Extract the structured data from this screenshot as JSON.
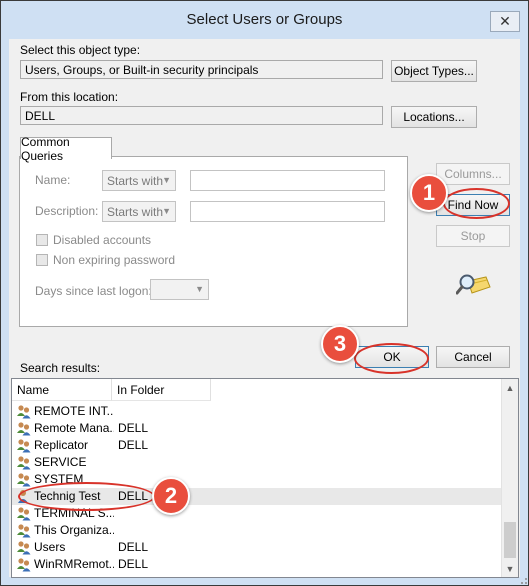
{
  "window": {
    "title": "Select Users or Groups",
    "close_glyph": "✕"
  },
  "object_type": {
    "label": "Select this object type:",
    "value": "Users, Groups, or Built-in security principals",
    "button": "Object Types..."
  },
  "location": {
    "label": "From this location:",
    "value": "DELL",
    "button": "Locations..."
  },
  "tab": {
    "label": "Common Queries"
  },
  "queries": {
    "name_label": "Name:",
    "name_mode": "Starts with",
    "description_label": "Description:",
    "description_mode": "Starts with",
    "disabled_accounts": "Disabled accounts",
    "non_expiring_password": "Non expiring password",
    "days_since_last_logon": "Days since last logon:",
    "combo_arrow": "▼"
  },
  "side_buttons": {
    "columns": "Columns...",
    "find_now": "Find Now",
    "stop": "Stop"
  },
  "actions": {
    "ok": "OK",
    "cancel": "Cancel"
  },
  "results": {
    "label": "Search results:",
    "headers": [
      "Name",
      "In Folder"
    ],
    "rows": [
      {
        "name": "REMOTE INT...",
        "folder": ""
      },
      {
        "name": "Remote Mana...",
        "folder": "DELL"
      },
      {
        "name": "Replicator",
        "folder": "DELL"
      },
      {
        "name": "SERVICE",
        "folder": ""
      },
      {
        "name": "SYSTEM",
        "folder": ""
      },
      {
        "name": "Technig Test",
        "folder": "DELL",
        "selected": true,
        "single_user": true
      },
      {
        "name": "TERMINAL S...",
        "folder": ""
      },
      {
        "name": "This Organiza...",
        "folder": ""
      },
      {
        "name": "Users",
        "folder": "DELL"
      },
      {
        "name": "WinRMRemot...",
        "folder": "DELL"
      }
    ]
  },
  "annotations": {
    "badge_1": "1",
    "badge_2": "2",
    "badge_3": "3"
  },
  "colors": {
    "badge": "#e94e3d",
    "ellipse": "#d8332a",
    "title_bg": "#cfe0f3"
  }
}
